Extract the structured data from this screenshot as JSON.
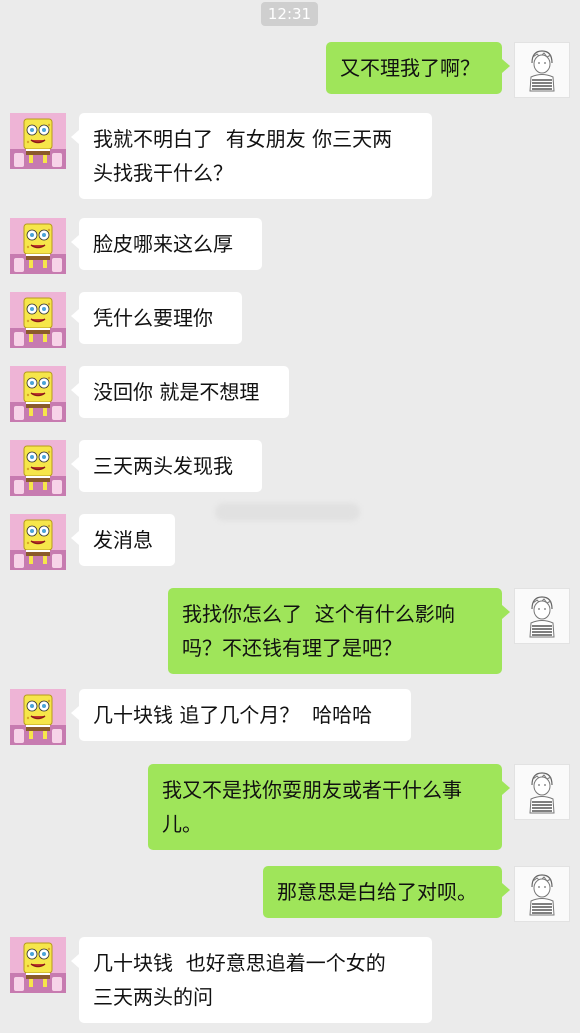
{
  "status": {
    "time": "12:31"
  },
  "colors": {
    "background": "#ebebeb",
    "outgoing_bubble": "#9fe55a",
    "incoming_bubble": "#ffffff"
  },
  "messages": [
    {
      "sender": "me",
      "avatar": "boy-sketch-icon",
      "text": "又不理我了啊？"
    },
    {
      "sender": "other",
      "avatar": "spongebob-icon",
      "text": "我就不明白了  有女朋友 你三天两\n头找我干什么？"
    },
    {
      "sender": "other",
      "avatar": "spongebob-icon",
      "text": "脸皮哪来这么厚"
    },
    {
      "sender": "other",
      "avatar": "spongebob-icon",
      "text": "凭什么要理你"
    },
    {
      "sender": "other",
      "avatar": "spongebob-icon",
      "text": "没回你 就是不想理"
    },
    {
      "sender": "other",
      "avatar": "spongebob-icon",
      "text": "三天两头发现我"
    },
    {
      "sender": "other",
      "avatar": "spongebob-icon",
      "text": "发消息"
    },
    {
      "sender": "me",
      "avatar": "boy-sketch-icon",
      "text": "我找你怎么了  这个有什么影响\n吗？不还钱有理了是吧？"
    },
    {
      "sender": "other",
      "avatar": "spongebob-icon",
      "text": "几十块钱 追了几个月？  哈哈哈"
    },
    {
      "sender": "me",
      "avatar": "boy-sketch-icon",
      "text": "我又不是找你耍朋友或者干什么事\n儿。"
    },
    {
      "sender": "me",
      "avatar": "boy-sketch-icon",
      "text": "那意思是白给了对呗。"
    },
    {
      "sender": "other",
      "avatar": "spongebob-icon",
      "text": "几十块钱  也好意思追着一个女的\n三天两头的问"
    }
  ]
}
